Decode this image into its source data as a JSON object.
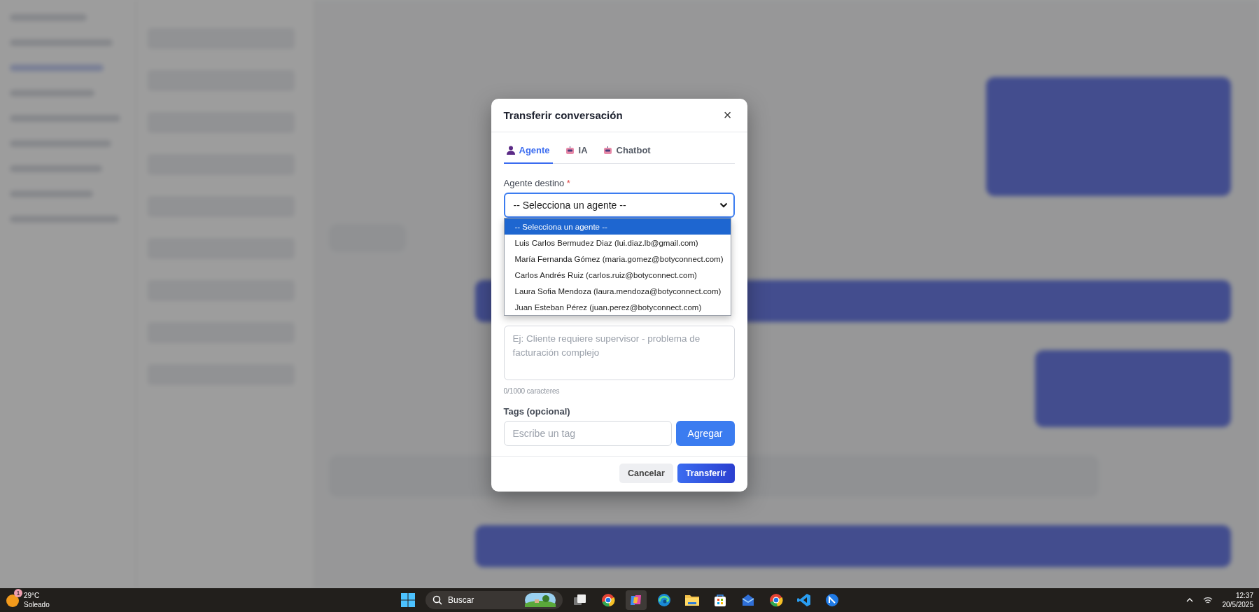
{
  "dialog": {
    "title": "Transferir conversación",
    "close": "×",
    "tabs": [
      {
        "label": "Agente",
        "kind": "person",
        "selected": true
      },
      {
        "label": "IA",
        "kind": "robot",
        "selected": false
      },
      {
        "label": "Chatbot",
        "kind": "robot",
        "selected": false
      }
    ],
    "agent_field": {
      "label": "Agente destino",
      "required_mark": "*",
      "value": "-- Selecciona un agente --",
      "expanded": true,
      "options": [
        {
          "label": "-- Selecciona un agente --",
          "selected": true
        },
        {
          "label": "Luis Carlos Bermudez Diaz (lui.diaz.lb@gmail.com)",
          "selected": false
        },
        {
          "label": "María Fernanda Gómez (maria.gomez@botyconnect.com)",
          "selected": false
        },
        {
          "label": "Carlos Andrés Ruiz (carlos.ruiz@botyconnect.com)",
          "selected": false
        },
        {
          "label": "Laura Sofia Mendoza (laura.mendoza@botyconnect.com)",
          "selected": false
        },
        {
          "label": "Juan Esteban Pérez (juan.perez@botyconnect.com)",
          "selected": false
        }
      ]
    },
    "reason_field": {
      "placeholder": "Ej: Cliente requiere supervisor - problema de facturación complejo",
      "counter": "0/1000 caracteres"
    },
    "tags": {
      "label": "Tags (opcional)",
      "placeholder": "Escribe un tag",
      "add_button": "Agregar"
    },
    "buttons": [
      {
        "label": "Cancelar",
        "kind": "secondary"
      },
      {
        "label": "Transferir",
        "kind": "primary"
      }
    ]
  },
  "taskbar": {
    "weather": {
      "badge": "1",
      "temperature": "29°C",
      "condition": "Soleado"
    },
    "search": {
      "label": "Buscar"
    },
    "apps": [
      {
        "kind": "start"
      },
      {
        "kind": "task-view"
      },
      {
        "kind": "chrome"
      },
      {
        "kind": "copilot",
        "selected": true
      },
      {
        "kind": "edge"
      },
      {
        "kind": "folder"
      },
      {
        "kind": "store"
      },
      {
        "kind": "mail"
      },
      {
        "kind": "chrome"
      },
      {
        "kind": "code"
      },
      {
        "kind": "app"
      }
    ],
    "clock": {
      "time": "12:37",
      "date": "20/5/2025"
    }
  }
}
